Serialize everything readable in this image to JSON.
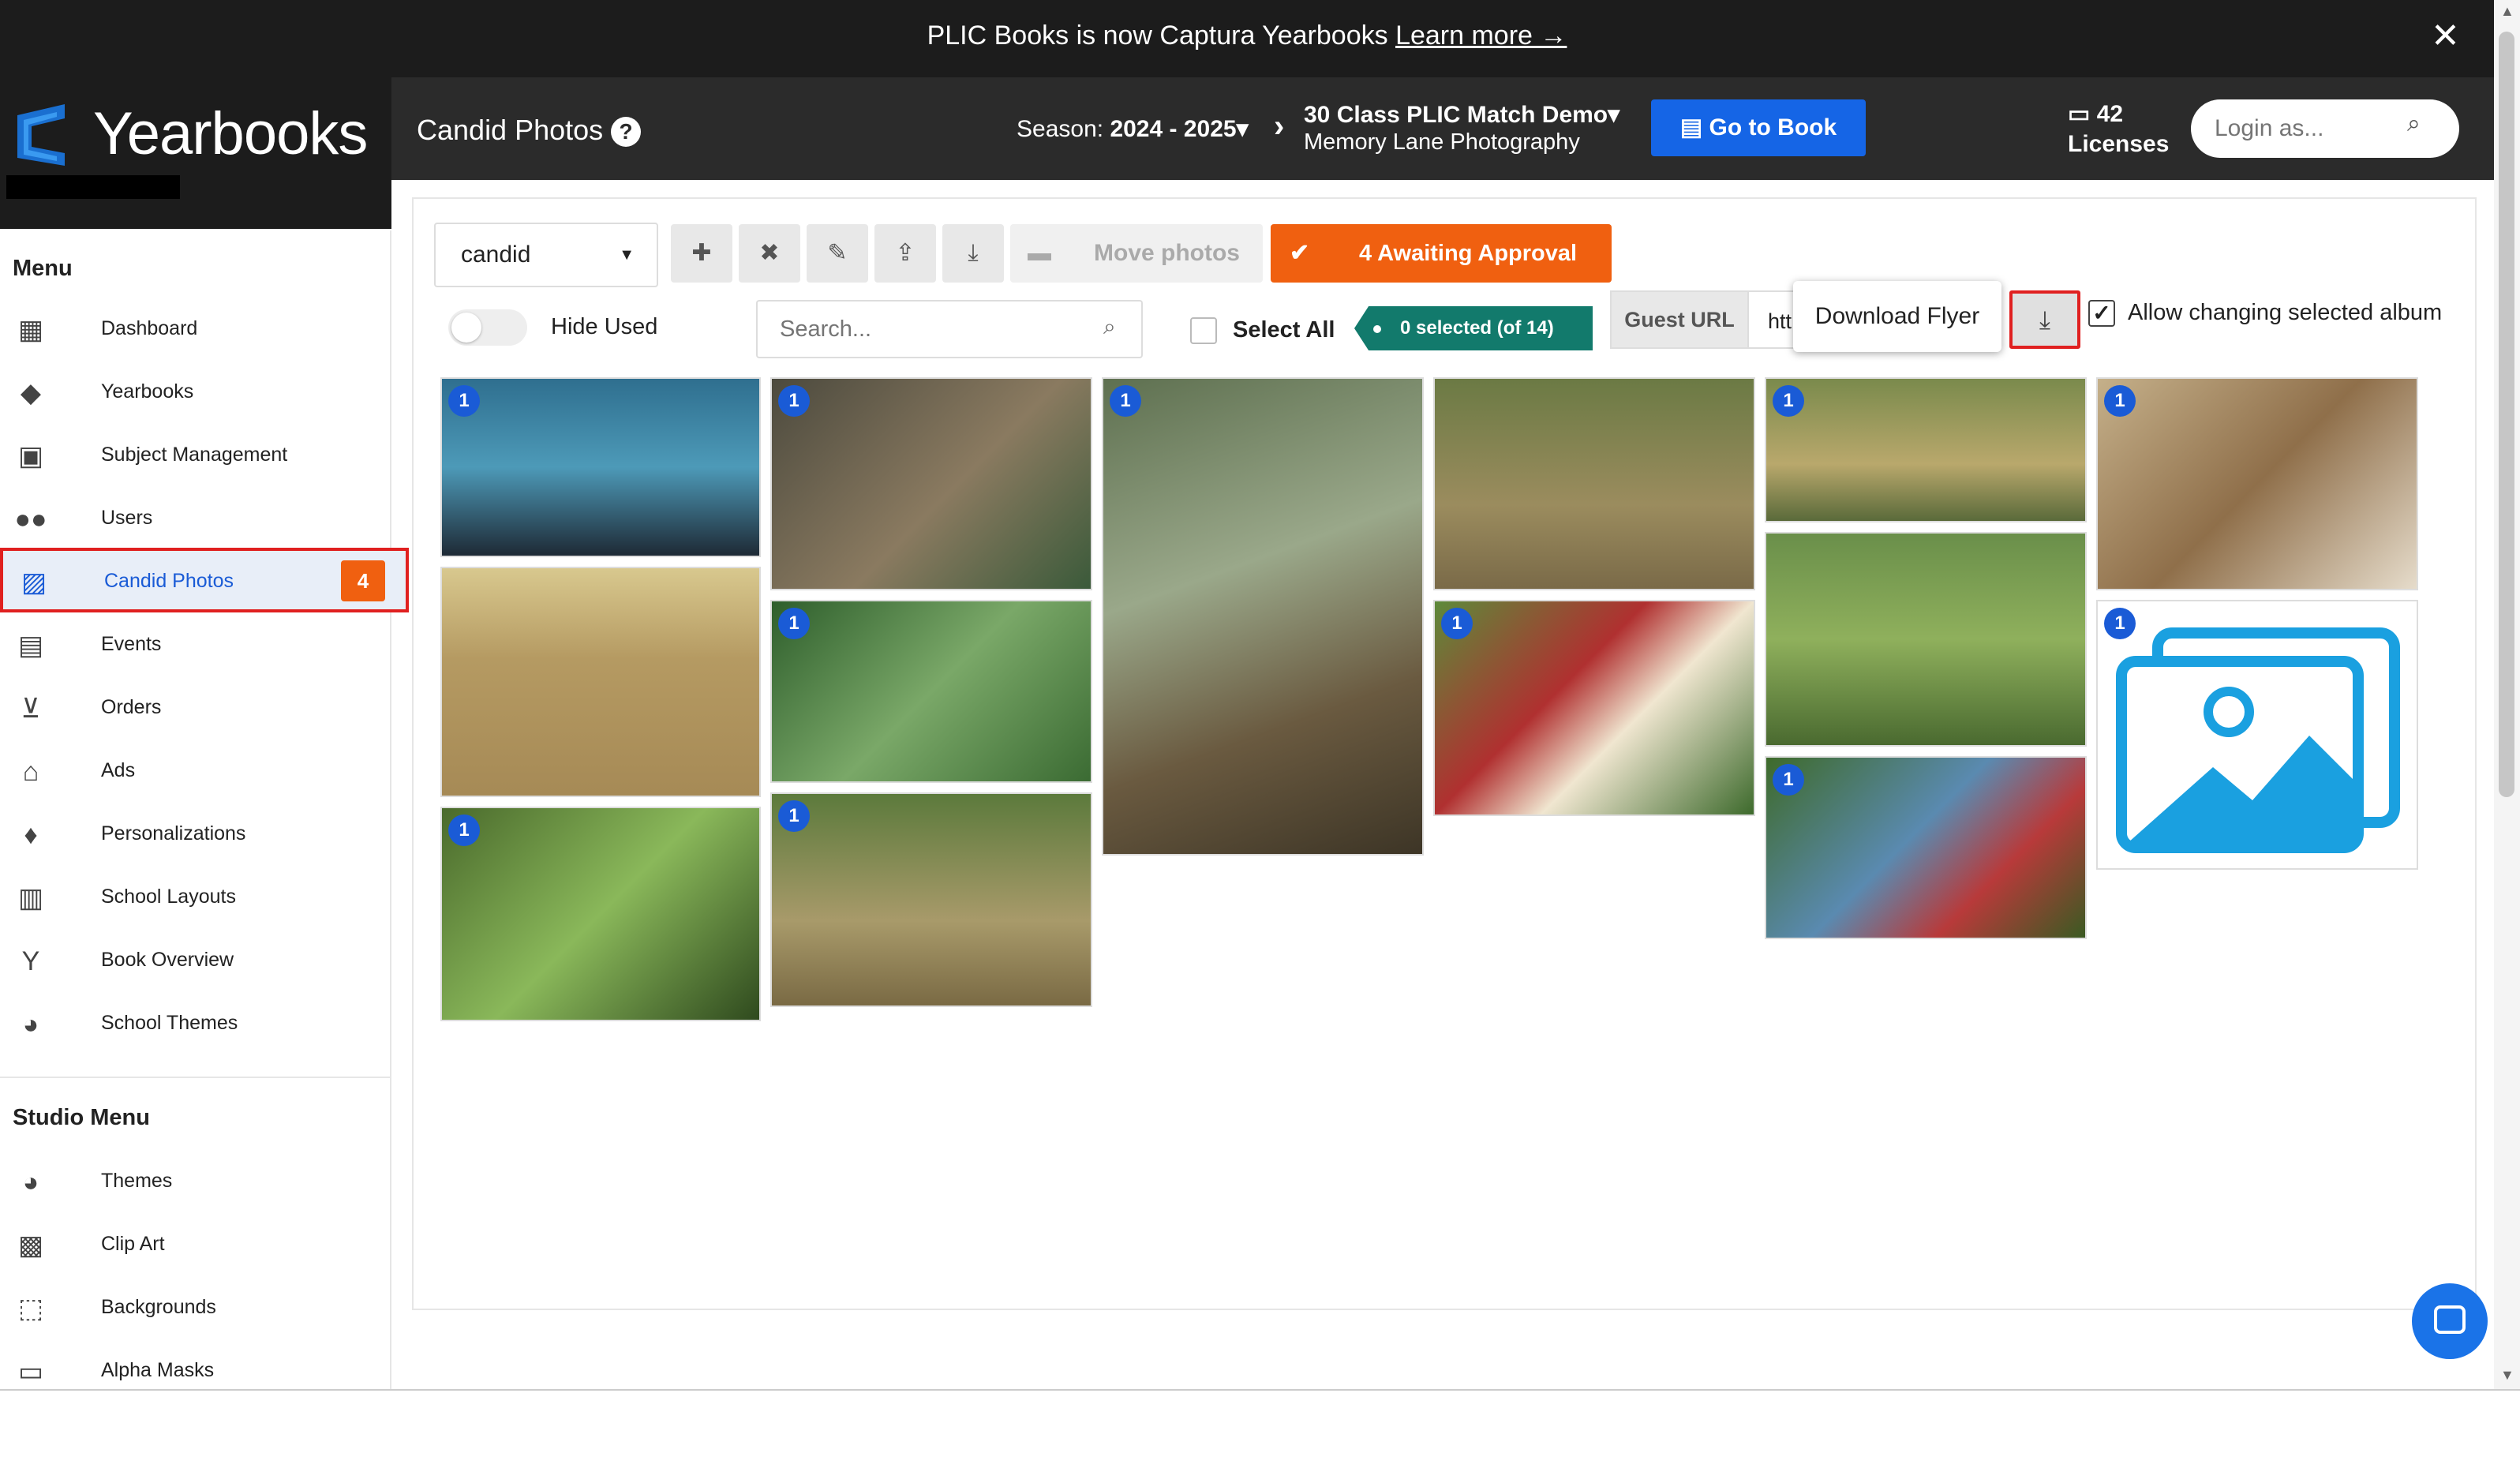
{
  "banner": {
    "text": "PLIC Books is now Captura Yearbooks ",
    "link": "Learn more →",
    "close_icon": "close-icon"
  },
  "header": {
    "logo_text": "Yearbooks",
    "page_title": "Candid Photos",
    "help": "?",
    "season_label": "Season:",
    "season_value": "2024 - 2025▾",
    "album_title": "30 Class PLIC Match Demo▾",
    "album_sub": "Memory Lane Photography",
    "goto_book": "Go to Book",
    "licenses_count": "42",
    "licenses_label": "Licenses",
    "login_placeholder": "Login as..."
  },
  "sidebar": {
    "menu_heading": "Menu",
    "items": [
      {
        "label": "Dashboard",
        "icon": "dashboard-icon"
      },
      {
        "label": "Yearbooks",
        "icon": "graduation-cap-icon"
      },
      {
        "label": "Subject Management",
        "icon": "id-card-icon"
      },
      {
        "label": "Users",
        "icon": "users-icon"
      },
      {
        "label": "Candid Photos",
        "icon": "photos-icon",
        "badge": "4"
      },
      {
        "label": "Events",
        "icon": "calendar-icon"
      },
      {
        "label": "Orders",
        "icon": "cart-icon"
      },
      {
        "label": "Ads",
        "icon": "basket-icon"
      },
      {
        "label": "Personalizations",
        "icon": "person-icon"
      },
      {
        "label": "School Layouts",
        "icon": "layout-icon"
      },
      {
        "label": "Book Overview",
        "icon": "fork-icon"
      },
      {
        "label": "School Themes",
        "icon": "palette-icon"
      }
    ],
    "studio_heading": "Studio Menu",
    "studio_items": [
      {
        "label": "Themes",
        "icon": "palette-icon"
      },
      {
        "label": "Clip Art",
        "icon": "clipart-icon"
      },
      {
        "label": "Backgrounds",
        "icon": "background-icon"
      },
      {
        "label": "Alpha Masks",
        "icon": "mask-icon"
      }
    ]
  },
  "toolbar": {
    "album_select": "candid",
    "move_photos": "Move photos",
    "awaiting": "4 Awaiting Approval",
    "hide_used": "Hide Used",
    "search_placeholder": "Search...",
    "select_all": "Select All",
    "selected_count": "0 selected (of 14)",
    "guest_url": "Guest URL",
    "guest_url_value": "htt",
    "tooltip": "Download Flyer",
    "allow_changing": "Allow changing selected album"
  },
  "photos": [
    {
      "badge": "1"
    },
    {
      "badge": "1"
    },
    {
      "badge": "1"
    },
    {
      "badge": ""
    },
    {
      "badge": "1"
    },
    {
      "badge": "1"
    },
    {
      "badge": ""
    },
    {
      "badge": "1"
    },
    {
      "badge": "1"
    },
    {
      "badge": ""
    },
    {
      "badge": "1"
    },
    {
      "badge": "1"
    },
    {
      "badge": "1"
    },
    {
      "badge": "1"
    }
  ],
  "colors": {
    "accent": "#1565e6",
    "orange": "#f06010",
    "teal": "#127a6c",
    "highlight": "#e02020"
  }
}
